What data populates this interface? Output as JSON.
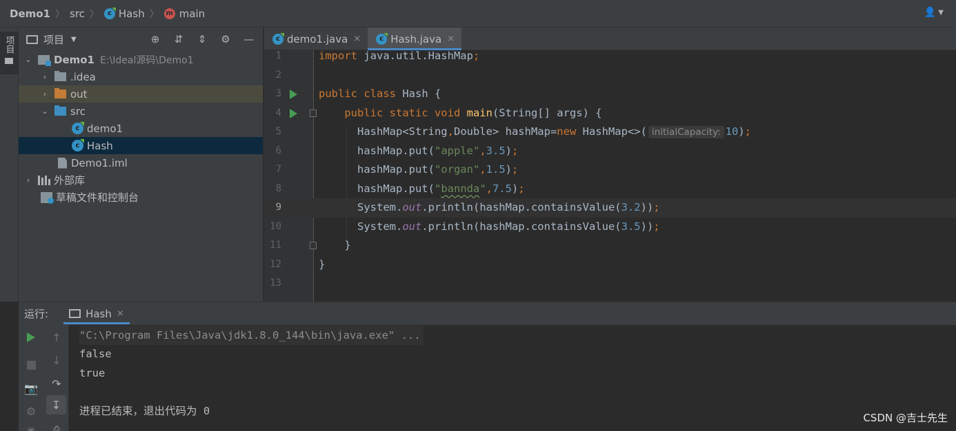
{
  "breadcrumb": {
    "project": "Demo1",
    "folder": "src",
    "class_name": "Hash",
    "class_icon_letter": "c",
    "method": "main",
    "method_icon_letter": "m"
  },
  "toolstrip": {
    "project_tab_label": "项目"
  },
  "project_panel": {
    "title": "项目",
    "tree": [
      {
        "label": "Demo1",
        "path_hint": "E:\\Ideal源码\\Demo1"
      },
      {
        "label": ".idea"
      },
      {
        "label": "out"
      },
      {
        "label": "src"
      },
      {
        "label": "demo1"
      },
      {
        "label": "Hash"
      },
      {
        "label": "Demo1.iml"
      },
      {
        "label": "外部库"
      },
      {
        "label": "草稿文件和控制台"
      }
    ]
  },
  "editor_tabs": [
    {
      "label": "demo1.java",
      "close": "×"
    },
    {
      "label": "Hash.java",
      "close": "×"
    }
  ],
  "editor": {
    "line_numbers": [
      "1",
      "2",
      "3",
      "4",
      "5",
      "6",
      "7",
      "8",
      "9",
      "10",
      "11",
      "12",
      "13"
    ],
    "lines": [
      {
        "tokens": [
          {
            "t": "import ",
            "c": "kw"
          },
          {
            "t": "java.util.HashMap",
            "c": ""
          },
          {
            "t": ";",
            "c": "kw"
          }
        ]
      },
      {
        "tokens": []
      },
      {
        "tokens": [
          {
            "t": "public class ",
            "c": "kw"
          },
          {
            "t": "Hash {",
            "c": ""
          }
        ]
      },
      {
        "tokens": [
          {
            "t": "    "
          },
          {
            "t": "public static void ",
            "c": "kw"
          },
          {
            "t": "main",
            "c": "fn"
          },
          {
            "t": "(String[] args) {",
            "c": ""
          }
        ]
      },
      {
        "tokens": [
          {
            "t": "      HashMap<String",
            "c": ""
          },
          {
            "t": ",",
            "c": "kw"
          },
          {
            "t": "Double> hashMap=",
            "c": ""
          },
          {
            "t": "new ",
            "c": "kw"
          },
          {
            "t": "HashMap<>(",
            "c": ""
          },
          {
            "t": "initialCapacity:",
            "c": "hint"
          },
          {
            "t": "10",
            "c": "num"
          },
          {
            "t": ")",
            "c": ""
          },
          {
            "t": ";",
            "c": "kw"
          }
        ]
      },
      {
        "tokens": [
          {
            "t": "      hashMap.put(",
            "c": ""
          },
          {
            "t": "\"apple\"",
            "c": "str"
          },
          {
            "t": ",",
            "c": "kw"
          },
          {
            "t": "3.5",
            "c": "num"
          },
          {
            "t": ")",
            "c": ""
          },
          {
            "t": ";",
            "c": "kw"
          }
        ]
      },
      {
        "tokens": [
          {
            "t": "      hashMap.put(",
            "c": ""
          },
          {
            "t": "\"organ\"",
            "c": "str"
          },
          {
            "t": ",",
            "c": "kw"
          },
          {
            "t": "1.5",
            "c": "num"
          },
          {
            "t": ")",
            "c": ""
          },
          {
            "t": ";",
            "c": "kw"
          }
        ]
      },
      {
        "tokens": [
          {
            "t": "      hashMap.put(",
            "c": ""
          },
          {
            "t": "\"",
            "c": "str"
          },
          {
            "t": "bannda",
            "c": "str typo"
          },
          {
            "t": "\"",
            "c": "str"
          },
          {
            "t": ",",
            "c": "kw"
          },
          {
            "t": "7.5",
            "c": "num"
          },
          {
            "t": ")",
            "c": ""
          },
          {
            "t": ";",
            "c": "kw"
          }
        ]
      },
      {
        "tokens": [
          {
            "t": "      System.",
            "c": ""
          },
          {
            "t": "out",
            "c": "stat"
          },
          {
            "t": ".println(hashMap.containsValue(",
            "c": ""
          },
          {
            "t": "3.2",
            "c": "num"
          },
          {
            "t": "))",
            "c": ""
          },
          {
            "t": ";",
            "c": "kw"
          }
        ]
      },
      {
        "tokens": [
          {
            "t": "      System.",
            "c": ""
          },
          {
            "t": "out",
            "c": "stat"
          },
          {
            "t": ".println(hashMap.containsValue(",
            "c": ""
          },
          {
            "t": "3.5",
            "c": "num"
          },
          {
            "t": "))",
            "c": ""
          },
          {
            "t": ";",
            "c": "kw"
          }
        ]
      },
      {
        "tokens": [
          {
            "t": "    }",
            "c": ""
          }
        ]
      },
      {
        "tokens": [
          {
            "t": "}",
            "c": ""
          }
        ]
      },
      {
        "tokens": []
      }
    ],
    "current_line": 9,
    "run_markers_on_lines": [
      3,
      4
    ]
  },
  "run_panel": {
    "label": "运行:",
    "tab_label": "Hash",
    "tab_close": "×",
    "console_lines": [
      "\"C:\\Program Files\\Java\\jdk1.8.0_144\\bin\\java.exe\" ...",
      "false",
      "true",
      "",
      "进程已结束，退出代码为 0"
    ]
  },
  "watermark": "CSDN @吉士先生",
  "colors": {
    "keyword": "#cc7832",
    "method": "#ffc66d",
    "string": "#6a8759",
    "number": "#6897bb",
    "static_field": "#9876aa",
    "selection": "#0d293e",
    "accent_tab": "#4a88c7"
  }
}
